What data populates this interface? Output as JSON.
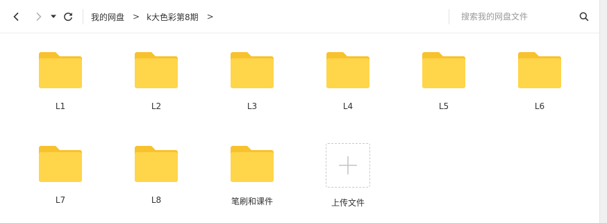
{
  "toolbar": {
    "back_icon": "chevron-left-icon",
    "forward_icon": "chevron-right-icon",
    "history_icon": "caret-down-icon",
    "refresh_icon": "refresh-icon",
    "breadcrumb": [
      "我的网盘",
      "k大色彩第8期"
    ],
    "separator": ">",
    "search_placeholder": "搜索我的网盘文件",
    "search_icon": "search-icon"
  },
  "items": [
    {
      "name": "L1",
      "type": "folder"
    },
    {
      "name": "L2",
      "type": "folder"
    },
    {
      "name": "L3",
      "type": "folder"
    },
    {
      "name": "L4",
      "type": "folder"
    },
    {
      "name": "L5",
      "type": "folder"
    },
    {
      "name": "L6",
      "type": "folder"
    },
    {
      "name": "L7",
      "type": "folder"
    },
    {
      "name": "L8",
      "type": "folder"
    },
    {
      "name": "笔刷和课件",
      "type": "folder"
    }
  ],
  "upload": {
    "label": "上传文件",
    "icon": "plus-icon"
  },
  "colors": {
    "folder_body": "#FFD54A",
    "folder_tab": "#F8C22E",
    "icon_active": "#333333",
    "icon_disabled": "#B5B5B5"
  }
}
